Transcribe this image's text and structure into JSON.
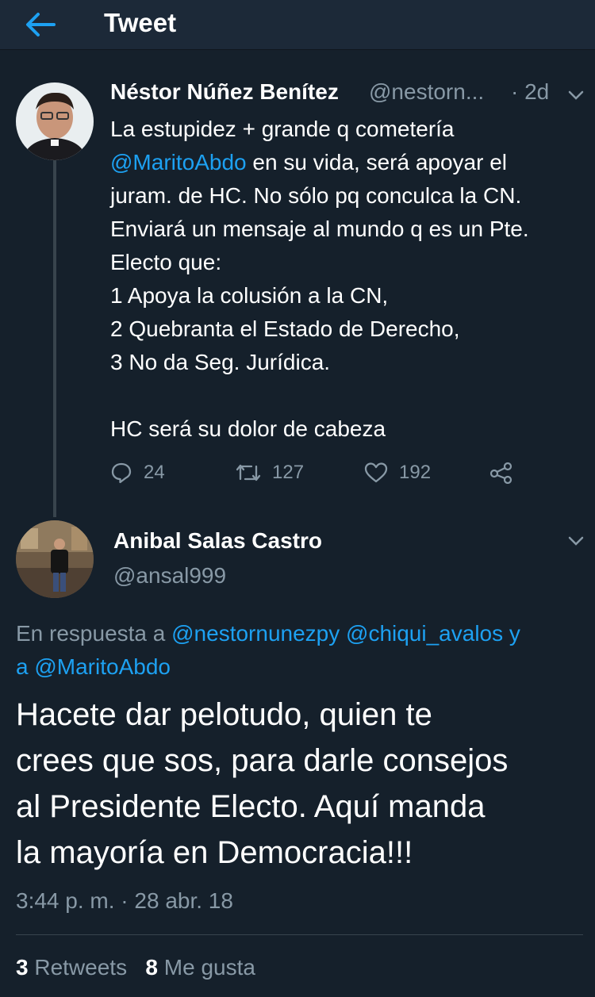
{
  "header": {
    "title": "Tweet",
    "back_icon": "arrow-left-icon"
  },
  "tweet1": {
    "author_name": "Néstor Núñez Benítez",
    "handle": "@nestorn...",
    "time": "· 2d",
    "lines": [
      "La estupidez + grande q cometería",
      "en su vida, será apoyar el",
      "juram. de HC. No sólo pq conculca la CN.",
      "Enviará un mensaje al mundo q es un Pte.",
      "Electo que:",
      "1 Apoya la colusión a la CN,",
      "2 Quebranta el Estado de Derecho,",
      "3 No da Seg. Jurídica.",
      "HC será su dolor de cabeza"
    ],
    "mention": "@MaritoAbdo",
    "actions": {
      "replies": "24",
      "retweets": "127",
      "likes": "192"
    }
  },
  "tweet2": {
    "author_name": "Anibal Salas Castro",
    "handle": "@ansal999",
    "reply_prefix": "En respuesta a",
    "reply_mention1": "@nestornunezpy",
    "reply_mention2": "@chiqui_avalos",
    "reply_and": "y",
    "reply_and_prefix": "a",
    "reply_mention3": "@MaritoAbdo",
    "text_lines": [
      "Hacete dar pelotudo, quien te",
      "crees que sos, para darle consejos",
      "al Presidente Electo. Aquí manda",
      "la mayoría en Democracia!!!"
    ],
    "timestamp": "3:44 p. m. · 28 abr. 18",
    "retweet_count": "3",
    "retweet_label": "Retweets",
    "like_count": "8",
    "like_label": "Me gusta"
  },
  "colors": {
    "background": "#15202b",
    "header": "#1c2938",
    "accent": "#1da1f2",
    "secondary_text": "#8899a6",
    "divider": "#38444d"
  }
}
